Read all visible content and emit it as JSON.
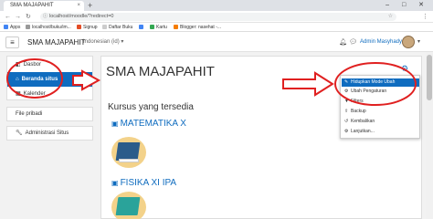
{
  "browser": {
    "tab_title": "SMA MAJAPAHIT",
    "tab_close": "×",
    "new_tab": "+",
    "window_controls": "–  □  ✕",
    "url": "localhost/moodle/?redirect=0",
    "bookmarks": [
      {
        "label": "Apps",
        "color": "#4285f4"
      },
      {
        "label": "localhost/buku/im...",
        "color": "#999999"
      },
      {
        "label": "Signup",
        "color": "#e44d26"
      },
      {
        "label": "Daftar Buku",
        "color": "#cccccc"
      },
      {
        "label": "",
        "color": "#4285f4"
      },
      {
        "label": "Kartu",
        "color": "#34a853"
      },
      {
        "label": "Blogger: nasehat -...",
        "color": "#f57d00"
      }
    ]
  },
  "navbar": {
    "menu_icon": "≡",
    "brand": "SMA MAJAPAHIT",
    "language": "Indonesian (id) ▾",
    "user_name": "Admin Masyhady"
  },
  "sidebar": {
    "items": [
      {
        "label": "Dasbor",
        "icon": "dashboard-icon"
      },
      {
        "label": "Beranda situs",
        "icon": "home-icon",
        "active": true
      },
      {
        "label": "Kalender",
        "icon": "calendar-icon"
      }
    ],
    "private_files": "File pribadi",
    "site_admin": "Administrasi Situs"
  },
  "main": {
    "title": "SMA MAJAPAHIT",
    "section_heading": "Kursus yang tersedia",
    "courses": [
      {
        "name": "MATEMATIKA X"
      },
      {
        "name": "FISIKA XI IPA"
      }
    ]
  },
  "menu": {
    "items": [
      {
        "label": "Hidupkan Mode Ubah",
        "icon": "pencil-icon",
        "highlighted": true
      },
      {
        "label": "Ubah Pengaturan",
        "icon": "gear-icon"
      },
      {
        "label": "Filters",
        "icon": "filter-icon"
      },
      {
        "label": "Backup",
        "icon": "upload-icon"
      },
      {
        "label": "Kembalikan",
        "icon": "restore-icon"
      },
      {
        "label": "Lanjutkan...",
        "icon": "gear-icon"
      }
    ]
  },
  "colors": {
    "accent": "#0f6cbf",
    "annotation": "#e02020"
  }
}
